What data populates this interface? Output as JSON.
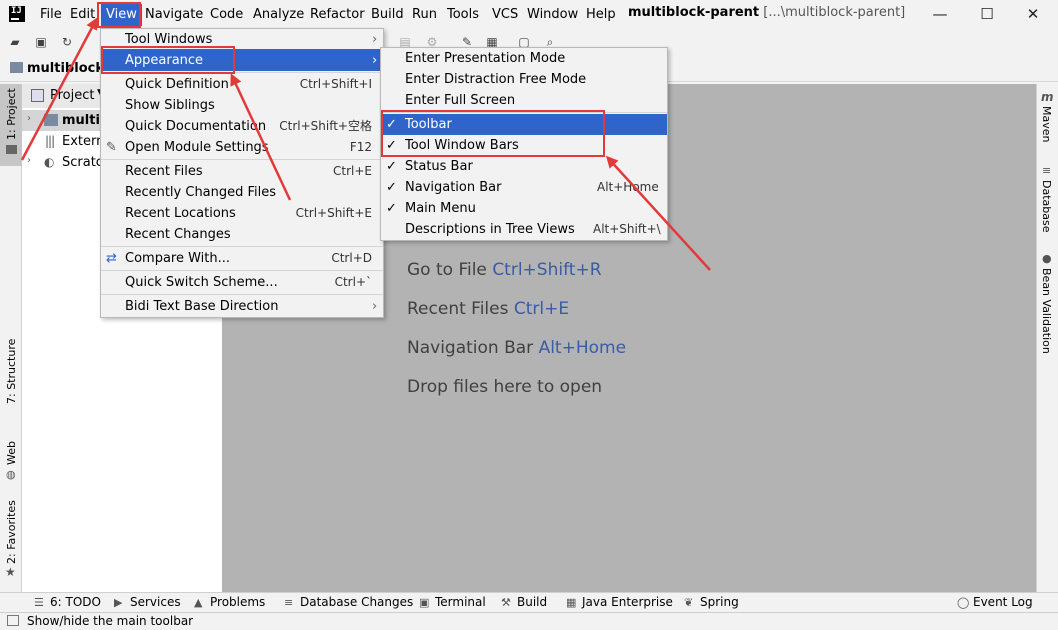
{
  "window": {
    "title_project": "multiblock-parent",
    "title_path": "[...\\multiblock-parent]",
    "minimize": "—",
    "maximize": "☐",
    "close": "✕"
  },
  "menubar": [
    "File",
    "Edit",
    "View",
    "Navigate",
    "Code",
    "Analyze",
    "Refactor",
    "Build",
    "Run",
    "Tools",
    "VCS",
    "Window",
    "Help"
  ],
  "navbar": {
    "project": "multiblock-"
  },
  "left_stripe": {
    "project": "1: Project",
    "structure": "7: Structure",
    "web": "Web",
    "favorites": "2: Favorites"
  },
  "project_panel": {
    "header": "Project",
    "tree": [
      "multibl",
      "Externa",
      "Scratch"
    ]
  },
  "view_menu": {
    "items": [
      {
        "label": "Tool Windows",
        "shortcut": "",
        "submenu": true
      },
      {
        "label": "Appearance",
        "shortcut": "",
        "submenu": true
      },
      {
        "label": "Quick Definition",
        "shortcut": "Ctrl+Shift+I"
      },
      {
        "label": "Show Siblings",
        "shortcut": ""
      },
      {
        "label": "Quick Documentation",
        "shortcut": "Ctrl+Shift+空格"
      },
      {
        "label": "Open Module Settings",
        "shortcut": "F12"
      },
      {
        "label": "Recent Files",
        "shortcut": "Ctrl+E"
      },
      {
        "label": "Recently Changed Files",
        "shortcut": ""
      },
      {
        "label": "Recent Locations",
        "shortcut": "Ctrl+Shift+E"
      },
      {
        "label": "Recent Changes",
        "shortcut": ""
      },
      {
        "label": "Compare With...",
        "shortcut": "Ctrl+D"
      },
      {
        "label": "Quick Switch Scheme...",
        "shortcut": "Ctrl+`"
      },
      {
        "label": "Bidi Text Base Direction",
        "shortcut": "",
        "submenu": true
      }
    ]
  },
  "appearance_menu": {
    "items": [
      {
        "label": "Enter Presentation Mode",
        "checked": false,
        "shortcut": ""
      },
      {
        "label": "Enter Distraction Free Mode",
        "checked": false,
        "shortcut": ""
      },
      {
        "label": "Enter Full Screen",
        "checked": false,
        "shortcut": ""
      },
      {
        "label": "Toolbar",
        "checked": true,
        "shortcut": ""
      },
      {
        "label": "Tool Window Bars",
        "checked": true,
        "shortcut": ""
      },
      {
        "label": "Status Bar",
        "checked": true,
        "shortcut": ""
      },
      {
        "label": "Navigation Bar",
        "checked": true,
        "shortcut": "Alt+Home"
      },
      {
        "label": "Main Menu",
        "checked": true,
        "shortcut": ""
      },
      {
        "label": "Descriptions in Tree Views",
        "checked": false,
        "shortcut": "Alt+Shift+\\"
      }
    ]
  },
  "editor_hints": [
    {
      "text": "Go to File",
      "key": "Ctrl+Shift+R"
    },
    {
      "text": "Recent Files",
      "key": "Ctrl+E"
    },
    {
      "text": "Navigation Bar",
      "key": "Alt+Home"
    },
    {
      "text": "Drop files here to open",
      "key": ""
    }
  ],
  "right_stripe": [
    "Maven",
    "Database",
    "Bean Validation"
  ],
  "bottom_tabs": [
    "6: TODO",
    "Services",
    "Problems",
    "Database Changes",
    "Terminal",
    "Build",
    "Java Enterprise",
    "Spring",
    "Event Log"
  ],
  "status_bar": {
    "text": "Show/hide the main toolbar"
  },
  "colors": {
    "highlight": "#2f65ca",
    "annotation": "#e23a3a",
    "editor_bg": "#b3b3b3",
    "link": "#3a5ba8"
  }
}
